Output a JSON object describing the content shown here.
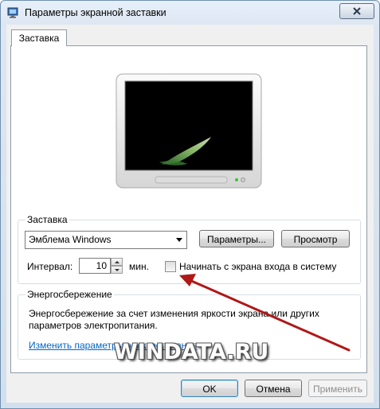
{
  "window": {
    "title": "Параметры экранной заставки"
  },
  "tabs": [
    {
      "label": "Заставка"
    }
  ],
  "screensaver_group": {
    "label": "Заставка",
    "selected": "Эмблема Windows",
    "params_button": "Параметры...",
    "preview_button": "Просмотр",
    "interval_label": "Интервал:",
    "interval_value": "10",
    "interval_unit": "мин.",
    "logon_checkbox_label": "Начинать с экрана входа в систему",
    "logon_checked": false
  },
  "power_group": {
    "label": "Энергосбережение",
    "description_line1": "Энергосбережение за счет изменения яркости экрана или других",
    "description_line2": "параметров электропитания.",
    "link": "Изменить параметры электропитания"
  },
  "watermark": "WINDATA.RU",
  "buttons": {
    "ok": "OK",
    "cancel": "Отмена",
    "apply": "Применить"
  },
  "colors": {
    "annotation_arrow": "#b01818",
    "link": "#0066cc"
  }
}
